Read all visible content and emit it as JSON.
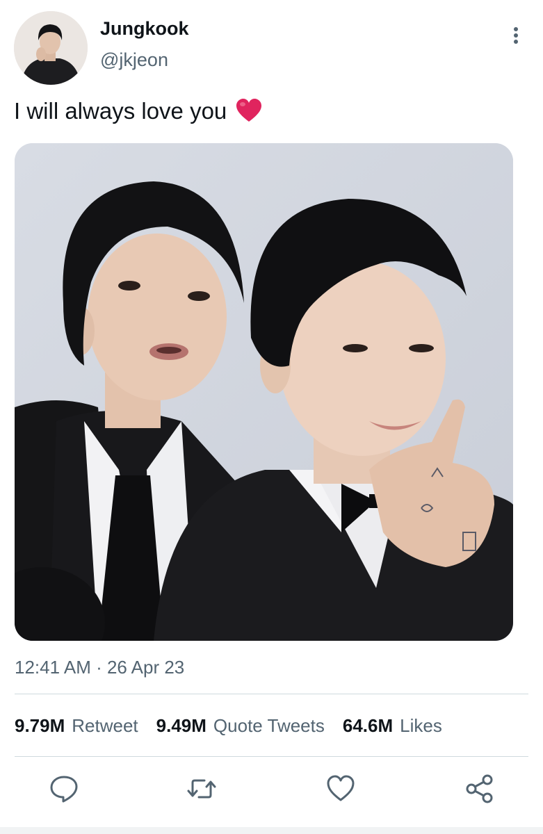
{
  "user": {
    "display_name": "Jungkook",
    "handle": "@jkjeon"
  },
  "tweet": {
    "text": "I will always love you",
    "emoji": "red-heart"
  },
  "meta": {
    "timestamp": "12:41 AM · 26 Apr 23"
  },
  "stats": [
    {
      "count": "9.79M",
      "label": "Retweet"
    },
    {
      "count": "9.49M",
      "label": "Quote Tweets"
    },
    {
      "count": "64.6M",
      "label": "Likes"
    }
  ],
  "actions": [
    {
      "icon": "reply-icon"
    },
    {
      "icon": "retweet-icon"
    },
    {
      "icon": "like-icon"
    },
    {
      "icon": "share-icon"
    }
  ],
  "colors": {
    "primary_text": "#0f1419",
    "secondary_text": "#536471",
    "divider": "#cfd9de",
    "heart": "#e0245e"
  }
}
